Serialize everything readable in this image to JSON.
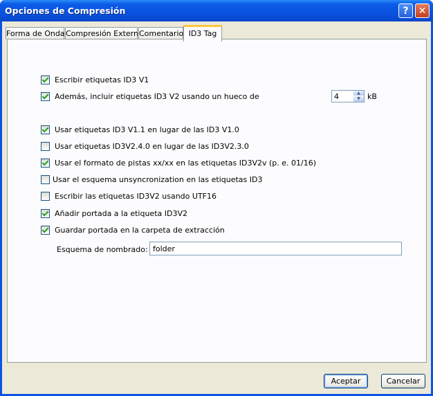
{
  "window": {
    "title": "Opciones de Compresión",
    "help_label": "?",
    "close_label": "✕"
  },
  "tabs": [
    {
      "label": "Forma de Onda",
      "active": false
    },
    {
      "label": "Compresión Externa",
      "active": false
    },
    {
      "label": "Comentario",
      "active": false
    },
    {
      "label": "ID3 Tag",
      "active": true
    }
  ],
  "options": [
    {
      "label": "Escribir etiquetas ID3 V1",
      "checked": true
    },
    {
      "label": "Además, incluir etiquetas ID3 V2 usando un hueco de",
      "checked": true
    },
    {
      "label": "Usar etiquetas ID3 V1.1 en lugar de las ID3 V1.0",
      "checked": true
    },
    {
      "label": "Usar etiquetas ID3V2.4.0 en lugar de las ID3V2.3.0",
      "checked": false
    },
    {
      "label": "Usar el formato de pistas xx/xx en las etiquetas ID3V2v (p. e. 01/16)",
      "checked": true
    },
    {
      "label": "Usar el esquema unsyncronization en las etiquetas ID3",
      "checked": false
    },
    {
      "label": "Escribir las etiquetas ID3V2 usando UTF16",
      "checked": false
    },
    {
      "label": "Añadir portada a la etiqueta ID3V2",
      "checked": true
    },
    {
      "label": "Guardar portada en la carpeta de extracción",
      "checked": true
    }
  ],
  "padding": {
    "value": "4",
    "unit": "kB"
  },
  "naming": {
    "label": "Esquema de nombrado:",
    "value": "folder"
  },
  "buttons": {
    "accept": "Aceptar",
    "cancel": "Cancelar"
  }
}
